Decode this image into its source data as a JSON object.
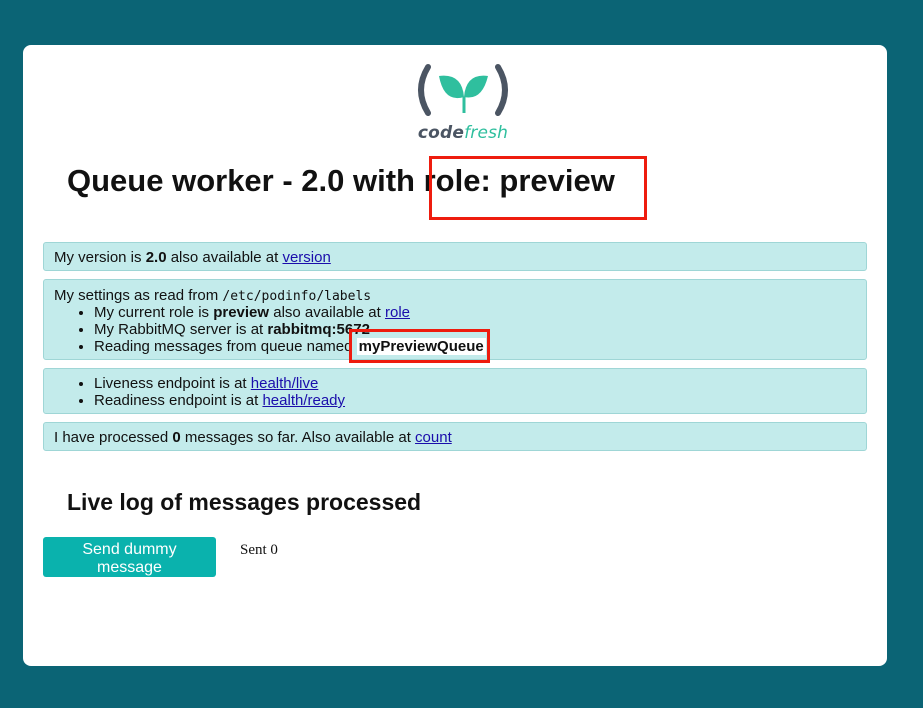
{
  "logo": {
    "text_code": "code",
    "text_fresh": "fresh",
    "icon": "codefresh-leaf-icon"
  },
  "title": {
    "prefix": "Queue worker - 2.0 with ",
    "highlight": "role: preview"
  },
  "version_panel": {
    "prefix": "My version is ",
    "version": "2.0",
    "suffix": " also available at ",
    "link": "version"
  },
  "settings_panel": {
    "intro": "My settings as read from ",
    "path": "/etc/podinfo/labels",
    "role_prefix": "My current role is ",
    "role": "preview",
    "role_suffix": " also available at ",
    "role_link": "role",
    "rabbit_prefix": "My RabbitMQ server is at ",
    "rabbit_host": "rabbitmq:5672",
    "queue_prefix": "Reading messages from queue named ",
    "queue_name": "myPreviewQueue"
  },
  "health_panel": {
    "liveness_prefix": "Liveness endpoint is at ",
    "liveness_link": "health/live",
    "readiness_prefix": "Readiness endpoint is at ",
    "readiness_link": "health/ready"
  },
  "count_panel": {
    "prefix": "I have processed ",
    "count": "0",
    "suffix": " messages so far. Also available at ",
    "link": "count"
  },
  "log": {
    "title": "Live log of messages processed",
    "button_label": "Send dummy message",
    "sent_text": "Sent 0"
  },
  "colors": {
    "background": "#0b6475",
    "panel": "#c3ebeb",
    "button": "#0ab2ad",
    "highlight_box": "#ee1c0e",
    "brand_green": "#2fbf9e"
  }
}
